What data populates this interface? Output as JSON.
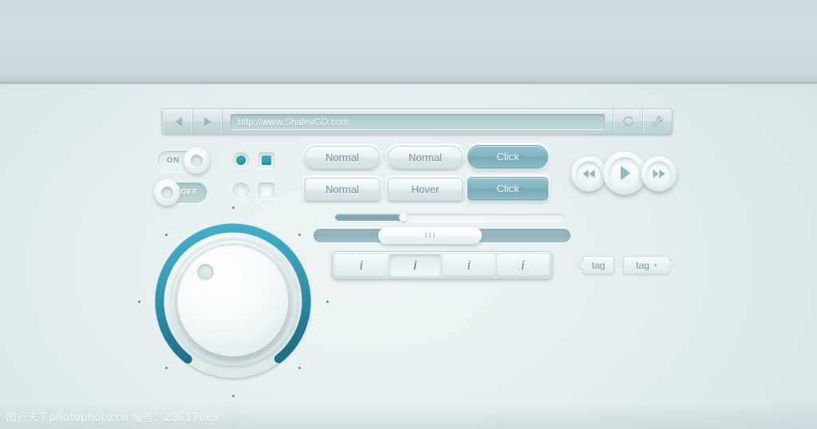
{
  "browser": {
    "back_label": "back",
    "forward_label": "forward",
    "url_value": "http://www.ShalevGD.com",
    "url_placeholder": "http://",
    "refresh_label": "refresh",
    "settings_label": "settings"
  },
  "toggles": [
    {
      "state": "on",
      "label": "ON"
    },
    {
      "state": "off",
      "label": "OFF"
    }
  ],
  "choices": {
    "radio_checked_label": "radio-checked",
    "radio_unchecked_label": "radio-unchecked",
    "checkbox_checked_label": "checkbox-checked",
    "checkbox_unchecked_label": "checkbox-unchecked"
  },
  "buttons": {
    "pill_row": [
      {
        "label": "Normal",
        "style": "light"
      },
      {
        "label": "Normal",
        "style": "light"
      },
      {
        "label": "Click",
        "style": "teal"
      }
    ],
    "rect_row": [
      {
        "label": "Normal",
        "style": "light"
      },
      {
        "label": "Hover",
        "style": "light"
      },
      {
        "label": "Click",
        "style": "teal"
      }
    ]
  },
  "media": {
    "rewind_label": "rewind",
    "play_label": "play",
    "forward_label": "fast-forward"
  },
  "progress": {
    "value_percent": 30,
    "label": "progress-bar"
  },
  "slider": {
    "value_percent": 42,
    "label": "range-slider",
    "grip_count": 3
  },
  "tabs": [
    {
      "label": "i",
      "state": "normal"
    },
    {
      "label": "i",
      "state": "active"
    },
    {
      "label": "i",
      "state": "normal"
    },
    {
      "label": "i",
      "state": "normal"
    }
  ],
  "tags": [
    {
      "label": "tag",
      "notch": "left",
      "has_bullet": false
    },
    {
      "label": "tag",
      "notch": "right",
      "has_bullet": true
    }
  ],
  "knob": {
    "label": "volume-knob",
    "arc_percent": 78,
    "tick_count": 8
  },
  "colors": {
    "accent_teal": "#2590a6",
    "button_teal": "#7fb3bf",
    "background": "#e6eff0",
    "top_band": "#cfdde0",
    "text_muted": "#6f8f97"
  },
  "watermark": {
    "text": "图行天下photophoto.cn  编号：28617069"
  }
}
